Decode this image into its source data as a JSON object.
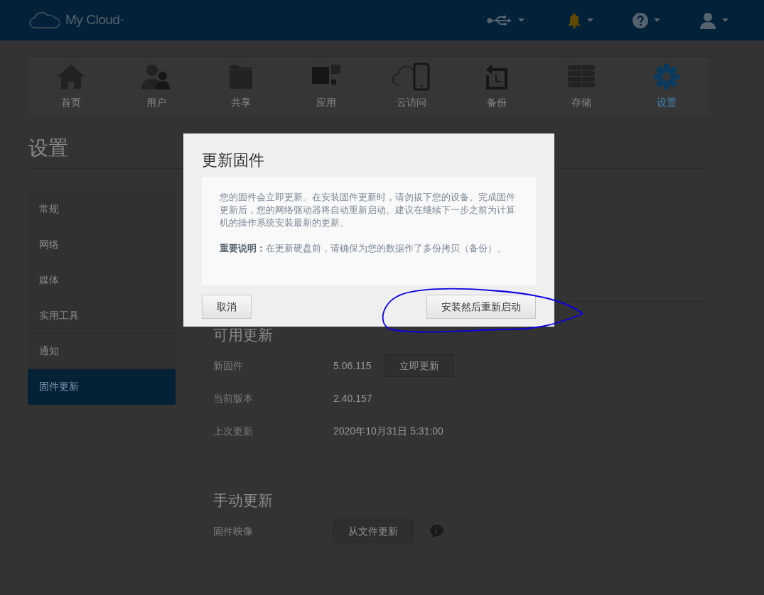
{
  "header": {
    "logo_text": "My Cloud",
    "logo_mark": "™"
  },
  "nav": [
    {
      "label": "首页",
      "selected": false
    },
    {
      "label": "用户",
      "selected": false
    },
    {
      "label": "共享",
      "selected": false
    },
    {
      "label": "应用",
      "selected": false
    },
    {
      "label": "云访问",
      "selected": false
    },
    {
      "label": "备份",
      "selected": false
    },
    {
      "label": "存储",
      "selected": false
    },
    {
      "label": "设置",
      "selected": true
    }
  ],
  "page_title": "设置",
  "sidebar": [
    {
      "label": "常规",
      "selected": false
    },
    {
      "label": "网络",
      "selected": false
    },
    {
      "label": "媒体",
      "selected": false
    },
    {
      "label": "实用工具",
      "selected": false
    },
    {
      "label": "通知",
      "selected": false
    },
    {
      "label": "固件更新",
      "selected": true
    }
  ],
  "available_update": {
    "title": "可用更新",
    "rows": [
      {
        "label": "新固件",
        "value": "5.06.115",
        "button": "立即更新"
      },
      {
        "label": "当前版本",
        "value": "2.40.157"
      },
      {
        "label": "上次更新",
        "value": "2020年10月31日 5:31:00"
      }
    ]
  },
  "manual_update": {
    "title": "手动更新",
    "label": "固件映像",
    "button": "从文件更新"
  },
  "dialog": {
    "title": "更新固件",
    "paragraphs": [
      "您的固件会立即更新。在安装固件更新时，请勿拔下您的设备。完成固件更新后，您的网络驱动器将自动重新启动。建议在继续下一步之前为计算机的操作系统安装最新的更新。",
      "**重要说明：**在更新硬盘前，请确保为您的数据作了多份拷贝（备份）。"
    ],
    "cancel": "取消",
    "confirm": "安装然后重新启动"
  },
  "annotation": {
    "kind": "hand_drawn_circle"
  }
}
